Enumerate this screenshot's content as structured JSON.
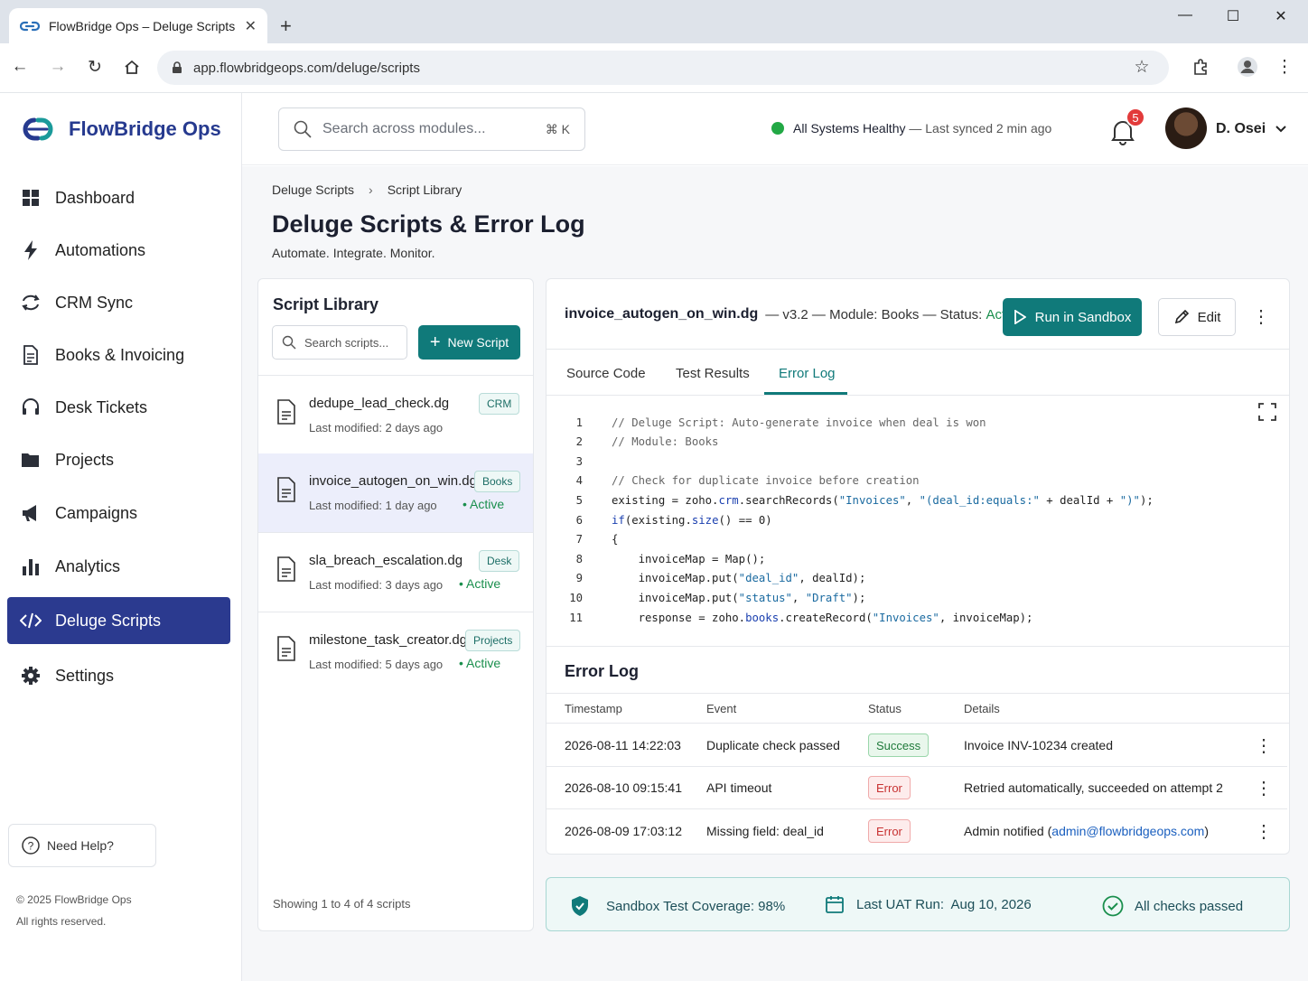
{
  "browser": {
    "tab_title": "FlowBridge Ops – Deluge Scripts",
    "url": "app.flowbridgeops.com/deluge/scripts"
  },
  "brand": {
    "name": "FlowBridge Ops",
    "color": "#263a8f",
    "accent": "#107a7a"
  },
  "sidebar": {
    "items": [
      {
        "label": "Dashboard",
        "icon": "dashboard-icon"
      },
      {
        "label": "Automations",
        "icon": "lightning-icon"
      },
      {
        "label": "CRM Sync",
        "icon": "sync-icon"
      },
      {
        "label": "Books & Invoicing",
        "icon": "document-icon"
      },
      {
        "label": "Desk Tickets",
        "icon": "headset-icon"
      },
      {
        "label": "Projects",
        "icon": "folder-icon"
      },
      {
        "label": "Campaigns",
        "icon": "megaphone-icon"
      },
      {
        "label": "Analytics",
        "icon": "bar-chart-icon"
      },
      {
        "label": "Deluge Scripts",
        "icon": "code-icon",
        "active": true
      },
      {
        "label": "Settings",
        "icon": "gear-icon"
      }
    ],
    "help": "Need Help?",
    "copyright": "© 2025 FlowBridge Ops",
    "rights": "All rights reserved."
  },
  "header": {
    "search_placeholder": "Search across modules...",
    "shortcut": "⌘ K",
    "status_main": "All Systems Healthy",
    "status_sync": " — Last synced 2 min ago",
    "notifications": "5",
    "user": "D. Osei"
  },
  "page": {
    "breadcrumb": [
      "Deluge Scripts",
      "Script Library"
    ],
    "title": "Deluge Scripts & Error Log",
    "subtitle": "Automate. Integrate. Monitor."
  },
  "library": {
    "title": "Script Library",
    "search_placeholder": "Search scripts...",
    "new_button": "New Script",
    "scripts": [
      {
        "name": "dedupe_lead_check.dg",
        "modified": "Last modified: 2 days ago",
        "tag": "CRM",
        "status": ""
      },
      {
        "name": "invoice_autogen_on_win.dg",
        "modified": "Last modified: 1 day ago",
        "tag": "Books",
        "status": "Active"
      },
      {
        "name": "sla_breach_escalation.dg",
        "modified": "Last modified: 3 days ago",
        "tag": "Desk",
        "status": "Active"
      },
      {
        "name": "milestone_task_creator.dg",
        "modified": "Last modified: 5 days ago",
        "tag": "Projects",
        "status": "Active"
      }
    ],
    "footer": "Showing 1 to 4 of 4 scripts"
  },
  "detail": {
    "filename": "invoice_autogen_on_win.dg",
    "meta": "— v3.2 — Module: Books — Status: ",
    "status": "Active",
    "run_button": "Run in Sandbox",
    "edit_button": "Edit",
    "tabs": [
      "Source Code",
      "Test Results",
      "Error Log"
    ],
    "active_tab": "Error Log",
    "code": [
      {
        "n": "1",
        "segs": [
          [
            "com",
            "// Deluge Script: Auto-generate invoice when deal is won"
          ]
        ]
      },
      {
        "n": "2",
        "segs": [
          [
            "com",
            "// Module: Books"
          ]
        ]
      },
      {
        "n": "3",
        "segs": [
          [
            "def",
            ""
          ]
        ]
      },
      {
        "n": "4",
        "segs": [
          [
            "com",
            "// Check for duplicate invoice before creation"
          ]
        ]
      },
      {
        "n": "5",
        "segs": [
          [
            "def",
            "existing = zoho."
          ],
          [
            "kw",
            "crm"
          ],
          [
            "def",
            ".searchRecords("
          ],
          [
            "str",
            "\"Invoices\""
          ],
          [
            "def",
            ", "
          ],
          [
            "str",
            "\"(deal_id:equals:\""
          ],
          [
            "def",
            " + dealId + "
          ],
          [
            "str",
            "\")\""
          ],
          [
            "def",
            ");"
          ]
        ]
      },
      {
        "n": "6",
        "segs": [
          [
            "kw",
            "if"
          ],
          [
            "def",
            "(existing."
          ],
          [
            "kw",
            "size"
          ],
          [
            "def",
            "() == 0)"
          ]
        ]
      },
      {
        "n": "7",
        "segs": [
          [
            "def",
            "{"
          ]
        ]
      },
      {
        "n": "8",
        "segs": [
          [
            "def",
            "    invoiceMap = Map();"
          ]
        ]
      },
      {
        "n": "9",
        "segs": [
          [
            "def",
            "    invoiceMap.put("
          ],
          [
            "str",
            "\"deal_id\""
          ],
          [
            "def",
            ", dealId);"
          ]
        ]
      },
      {
        "n": "10",
        "segs": [
          [
            "def",
            "    invoiceMap.put("
          ],
          [
            "str",
            "\"status\""
          ],
          [
            "def",
            ", "
          ],
          [
            "str",
            "\"Draft\""
          ],
          [
            "def",
            ");"
          ]
        ]
      },
      {
        "n": "11",
        "segs": [
          [
            "def",
            "    response = zoho."
          ],
          [
            "kw",
            "books"
          ],
          [
            "def",
            ".createRecord("
          ],
          [
            "str",
            "\"Invoices\""
          ],
          [
            "def",
            ", invoiceMap);"
          ]
        ]
      }
    ]
  },
  "error_log": {
    "title": "Error Log",
    "columns": [
      "Timestamp",
      "Event",
      "Status",
      "Details"
    ],
    "rows": [
      {
        "timestamp": "2026-08-11 14:22:03",
        "event": "Duplicate check passed",
        "status": "Success",
        "details": "Invoice INV-10234 created",
        "email": ""
      },
      {
        "timestamp": "2026-08-10 09:15:41",
        "event": "API timeout",
        "status": "Error",
        "details": "Retried automatically, succeeded on attempt 2",
        "email": ""
      },
      {
        "timestamp": "2026-08-09 17:03:12",
        "event": "Missing field: deal_id",
        "status": "Error",
        "details": "Admin notified (",
        "email": "admin@flowbridgeops.com",
        "tail": ")"
      }
    ]
  },
  "coverage": {
    "coverage": "Sandbox Test Coverage: 98%",
    "uat": "Last UAT Run:  Aug 10, 2026",
    "checks": "All checks passed"
  }
}
